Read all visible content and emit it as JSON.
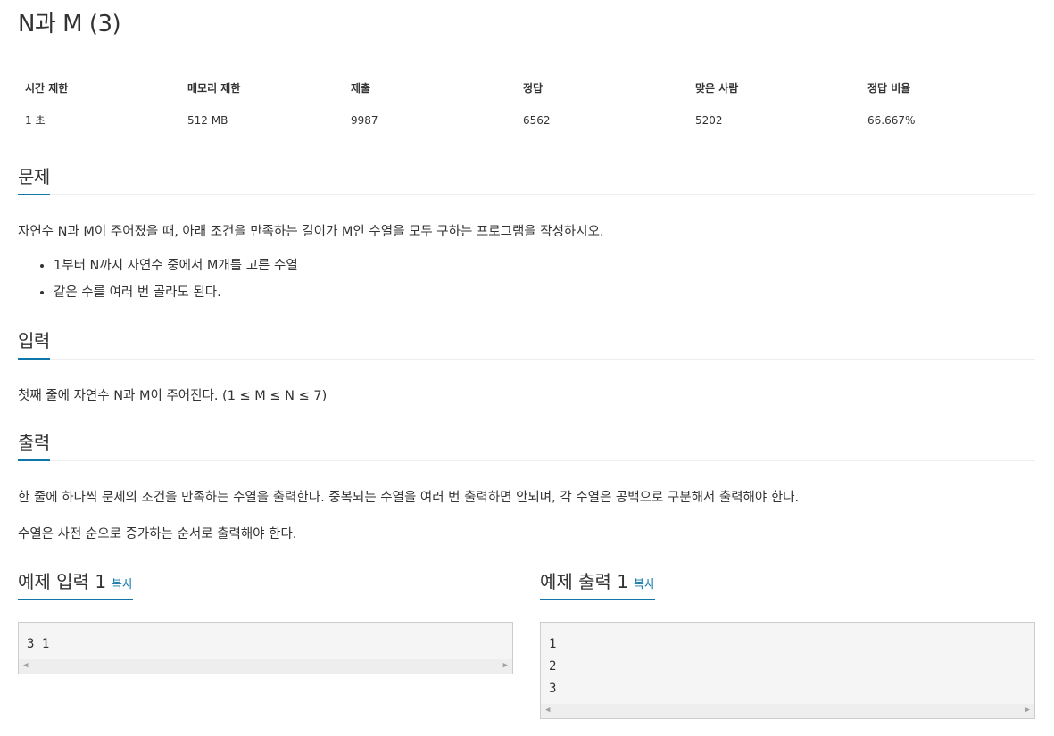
{
  "title": "N과 M (3)",
  "stats": {
    "headers": [
      "시간 제한",
      "메모리 제한",
      "제출",
      "정답",
      "맞은 사람",
      "정답 비율"
    ],
    "values": [
      "1 초",
      "512 MB",
      "9987",
      "6562",
      "5202",
      "66.667%"
    ]
  },
  "problem": {
    "heading": "문제",
    "text": "자연수 N과 M이 주어졌을 때, 아래 조건을 만족하는 길이가 M인 수열을 모두 구하는 프로그램을 작성하시오.",
    "bullets": [
      "1부터 N까지 자연수 중에서 M개를 고른 수열",
      "같은 수를 여러 번 골라도 된다."
    ]
  },
  "input": {
    "heading": "입력",
    "text": "첫째 줄에 자연수 N과 M이 주어진다. (1 ≤ M ≤ N ≤ 7)"
  },
  "output": {
    "heading": "출력",
    "text1": "한 줄에 하나씩 문제의 조건을 만족하는 수열을 출력한다. 중복되는 수열을 여러 번 출력하면 안되며, 각 수열은 공백으로 구분해서 출력해야 한다.",
    "text2": "수열은 사전 순으로 증가하는 순서로 출력해야 한다."
  },
  "samples": {
    "copy_label": "복사",
    "input_heading": "예제 입력 1",
    "output_heading": "예제 출력 1",
    "input_text": "3 1",
    "output_text": "1\n2\n3",
    "scroll_left": "◀",
    "scroll_right": "▶"
  }
}
